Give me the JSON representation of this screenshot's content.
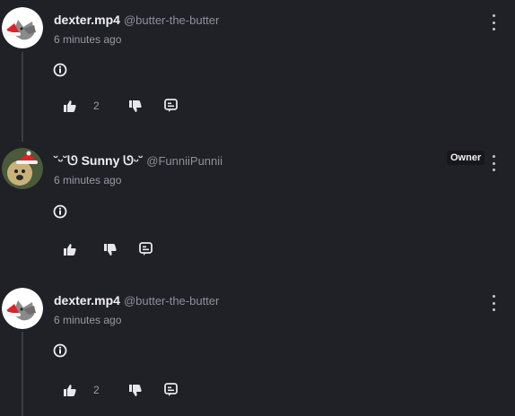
{
  "comments": [
    {
      "display_name": "dexter.mp4",
      "handle": "@butter-the-butter",
      "timestamp": "6 minutes ago",
      "likes": "2",
      "avatar_icon": "wolf-santa-hat-avatar",
      "owner_badge": ""
    },
    {
      "display_name": "˘ᵕ˘ᘎ Sunny ᘎᵕ˘",
      "handle": "@FunniiPunnii",
      "timestamp": "6 minutes ago",
      "likes": "",
      "avatar_icon": "dog-santa-hat-avatar",
      "owner_badge": "Owner"
    },
    {
      "display_name": "dexter.mp4",
      "handle": "@butter-the-butter",
      "timestamp": "6 minutes ago",
      "likes": "2",
      "avatar_icon": "wolf-santa-hat-avatar",
      "owner_badge": ""
    }
  ],
  "icons": {
    "body": "info-circle-icon",
    "like": "thumbs-up-icon",
    "dislike": "thumbs-down-icon",
    "reply": "reply-bubble-icon",
    "menu": "kebab-menu-icon"
  },
  "colors": {
    "background": "#202027",
    "owner_badge_bg": "#17171c"
  }
}
